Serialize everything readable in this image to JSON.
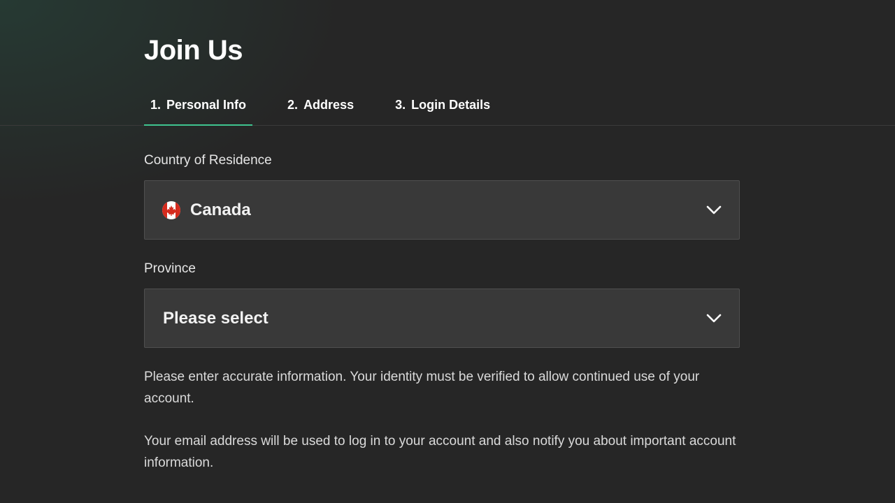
{
  "page": {
    "title": "Join Us"
  },
  "tabs": [
    {
      "number": "1.",
      "label": "Personal Info",
      "active": true
    },
    {
      "number": "2.",
      "label": "Address",
      "active": false
    },
    {
      "number": "3.",
      "label": "Login Details",
      "active": false
    }
  ],
  "form": {
    "country": {
      "label": "Country of Residence",
      "value": "Canada",
      "flag_icon": "canada-flag-icon"
    },
    "province": {
      "label": "Province",
      "value": "Please select"
    }
  },
  "notes": {
    "accuracy": "Please enter accurate information. Your identity must be verified to allow continued use of your account.",
    "email": "Your email address will be used to log in to your account and also notify you about important account information."
  },
  "colors": {
    "background": "#262626",
    "accent": "#3fc48f",
    "field_background": "#393939"
  }
}
